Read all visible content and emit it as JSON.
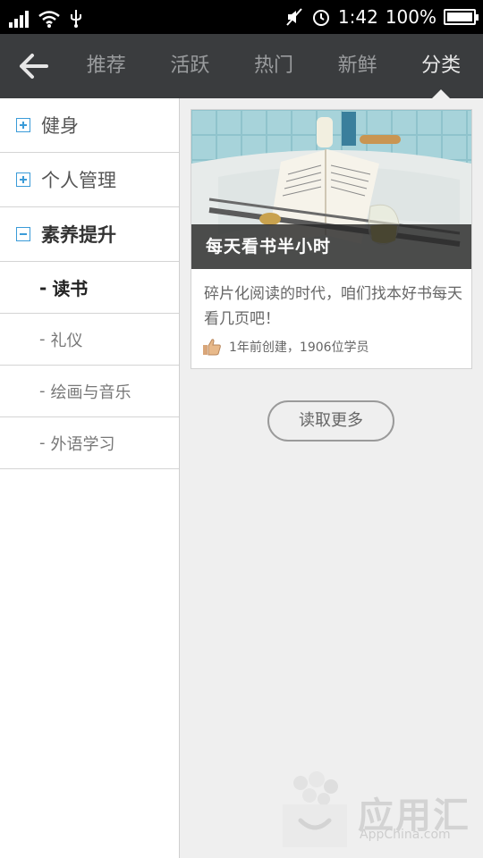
{
  "status_bar": {
    "time": "1:42",
    "battery": "100%",
    "battery_level": 1.0
  },
  "header": {
    "tabs": [
      {
        "label": "推荐"
      },
      {
        "label": "活跃"
      },
      {
        "label": "热门"
      },
      {
        "label": "新鲜"
      },
      {
        "label": "分类",
        "active": true
      }
    ]
  },
  "sidebar": {
    "categories": [
      {
        "label": "健身",
        "expanded": false
      },
      {
        "label": "个人管理",
        "expanded": false
      },
      {
        "label": "素养提升",
        "expanded": true
      }
    ],
    "subcategories": [
      {
        "label": "读书",
        "active": true
      },
      {
        "label": "礼仪"
      },
      {
        "label": "绘画与音乐"
      },
      {
        "label": "外语学习"
      }
    ]
  },
  "card": {
    "title": "每天看书半小时",
    "description": "碎片化阅读的时代，咱们找本好书每天看几页吧！",
    "meta": "1年前创建，1906位学员"
  },
  "load_more": "读取更多",
  "watermark": {
    "name": "应用汇",
    "site": "AppChina.com"
  },
  "colors": {
    "header_bg": "#3a3c3e",
    "accent": "#3a9bd8"
  }
}
